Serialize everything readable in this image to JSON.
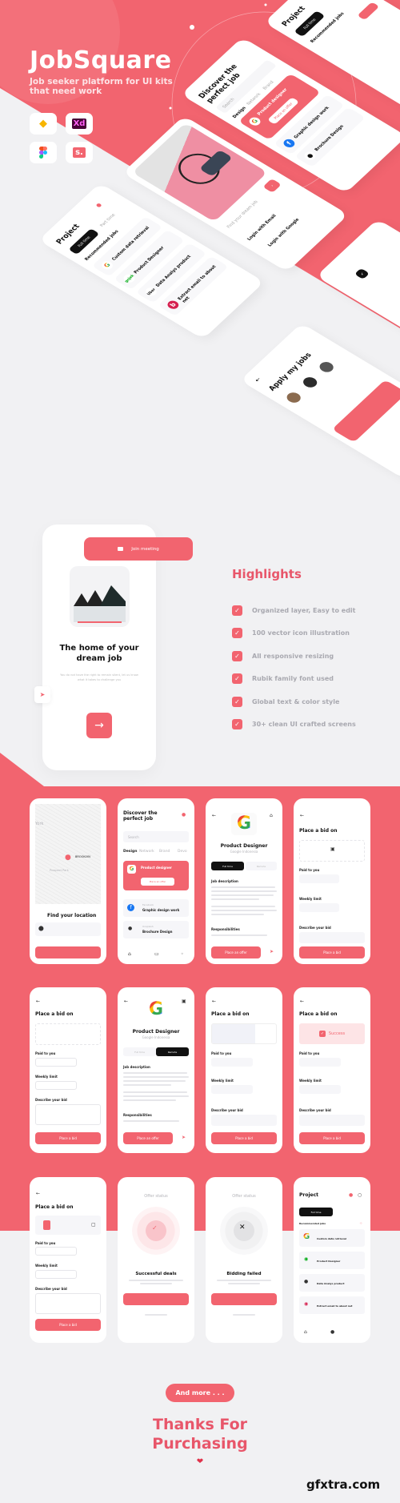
{
  "colors": {
    "accent": "#f2646f",
    "heading": "#e8566a",
    "background": "#f1f1f3",
    "dark": "#111111"
  },
  "hero": {
    "title": "JobSquare",
    "subtitle": "Job seeker platform for UI kits that need work",
    "tools": [
      {
        "icon": "sketch-icon",
        "label": ""
      },
      {
        "icon": "xd-icon",
        "label": "Xd"
      },
      {
        "icon": "figma-icon",
        "label": ""
      },
      {
        "icon": "craft-icon",
        "label": "s."
      }
    ]
  },
  "mockups": {
    "project": {
      "title": "Project",
      "tab_active": "Full time",
      "tab_other": "Part time",
      "section": "Recommended jobs",
      "items": [
        "Custom data retrieval",
        "Product Designer",
        "Data Analys product",
        "Extract email to about net"
      ],
      "logos": [
        "G",
        "gojek",
        "Uber",
        "b"
      ]
    },
    "login": {
      "tagline": "Find your dream job",
      "email_btn": "Login with Email",
      "google_btn": "Login with Google"
    },
    "discover": {
      "title": "Discover the perfect job",
      "search": "Search",
      "tabs": [
        "Design",
        "Network",
        "Brand",
        "Devo"
      ],
      "featured": "Product designer",
      "offer_btn": "Place an offer",
      "items": [
        "Graphic design work",
        "Brochure Design"
      ]
    },
    "apply": {
      "title": "Apply my jobs"
    }
  },
  "onboarding": {
    "join_label": "Join meeting",
    "title": "The home of your dream job",
    "description": "You do not have the right to remain silent, let us know what it takes to challenge you"
  },
  "highlights": {
    "title": "Highlights",
    "items": [
      "Organized layer, Easy to edit",
      "100 vector icon illustration",
      "All responsive resizing",
      "Rubik family font used",
      "Global text & color style",
      "30+ clean UI crafted screens"
    ]
  },
  "screens": {
    "map": {
      "city": "York",
      "district": "BROOKLYN",
      "park": "Prospect Park",
      "title": "Find your location"
    },
    "discover": {
      "title": "Discover the perfect job",
      "search": "Search",
      "tabs": [
        "Design",
        "Network",
        "Brand",
        "Devo"
      ],
      "featured": "Product designer",
      "offer_btn": "Place an offer",
      "items": [
        {
          "company": "Facebook",
          "job": "Graphic design work"
        },
        {
          "company": "Unsplash",
          "job": "Brochure Design"
        }
      ]
    },
    "detail": {
      "title": "Product Designer",
      "company": "Google Indonesia",
      "tab_full": "Full time",
      "tab_remote": "Remote",
      "desc_label": "Job description",
      "resp_label": "Responsibilities",
      "offer_btn": "Place an offer"
    },
    "bid": {
      "title": "Place a bid on",
      "paid": "Paid to you",
      "weekly": "Weekly limit",
      "describe": "Describe your bid",
      "button": "Place a bid",
      "success": "Success"
    },
    "status": {
      "header": "Offer status",
      "success_title": "Successful deals",
      "failed_title": "Bidding failed"
    },
    "project": {
      "title": "Project",
      "tab_active": "Full time",
      "section": "Recommended jobs",
      "items": [
        "Custom data retrieval",
        "Product Designer",
        "Data Analys product",
        "Extract email to about net"
      ]
    }
  },
  "footer": {
    "more": "And more . . .",
    "thanks": "Thanks For Purchasing",
    "heart": "❤",
    "watermark": "gfxtra.com"
  }
}
